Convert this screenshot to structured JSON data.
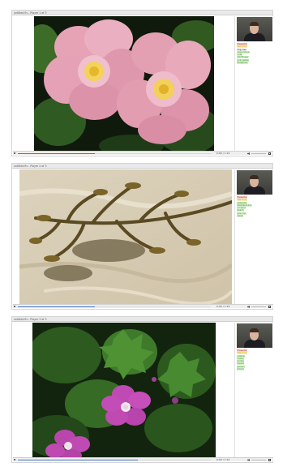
{
  "panels": [
    {
      "title": "untitled.flv - Player 1 of 3",
      "photo_subject": "pink wild rose flowers",
      "progress": 0.4,
      "time": "0:00 / 1:12",
      "chat": [
        {
          "text": "Presenter",
          "color": "#cc2222"
        },
        {
          "text": "Welcome",
          "color": "#d4a400"
        },
        {
          "text": "dog rose",
          "color": "#222222"
        },
        {
          "text": "rosa canina",
          "color": "#3a9a2a"
        },
        {
          "text": "note",
          "color": "#3a9a2a"
        },
        {
          "text": "wild flower",
          "color": "#3a9a2a"
        },
        {
          "text": "pink petals",
          "color": "#3a9a2a"
        },
        {
          "text": "hedgerow",
          "color": "#3a9a2a"
        }
      ]
    },
    {
      "title": "untitled.flv - Player 2 of 3",
      "photo_subject": "brown seaweed on sand",
      "progress": 0.4,
      "time": "0:00 / 1:12",
      "chat": [
        {
          "text": "Presenter",
          "color": "#cc2222"
        },
        {
          "text": "Welcome",
          "color": "#d4a400"
        },
        {
          "text": "seaweed",
          "color": "#3a9a2a"
        },
        {
          "text": "bladderwrack",
          "color": "#3a9a2a"
        },
        {
          "text": "on sand",
          "color": "#3a9a2a"
        },
        {
          "text": "beach",
          "color": "#3a9a2a"
        },
        {
          "text": "tide line",
          "color": "#3a9a2a"
        },
        {
          "text": "shore",
          "color": "#3a9a2a"
        }
      ]
    },
    {
      "title": "untitled.flv - Player 3 of 3",
      "photo_subject": "purple mallow flowers",
      "progress": 0.62,
      "time": "0:00 / 1:12",
      "chat": [
        {
          "text": "Presenter",
          "color": "#cc2222"
        },
        {
          "text": "Welcome",
          "color": "#d4a400"
        },
        {
          "text": "mallow",
          "color": "#3a9a2a"
        },
        {
          "text": "malva",
          "color": "#3a9a2a"
        },
        {
          "text": "purple",
          "color": "#3a9a2a"
        },
        {
          "text": "leaves",
          "color": "#3a9a2a"
        },
        {
          "text": "garden",
          "color": "#3a9a2a"
        },
        {
          "text": "bloom",
          "color": "#3a9a2a"
        }
      ]
    }
  ],
  "colors": {
    "progress_fill": "#4a78c8",
    "titlebar": "#e9e9e9"
  }
}
